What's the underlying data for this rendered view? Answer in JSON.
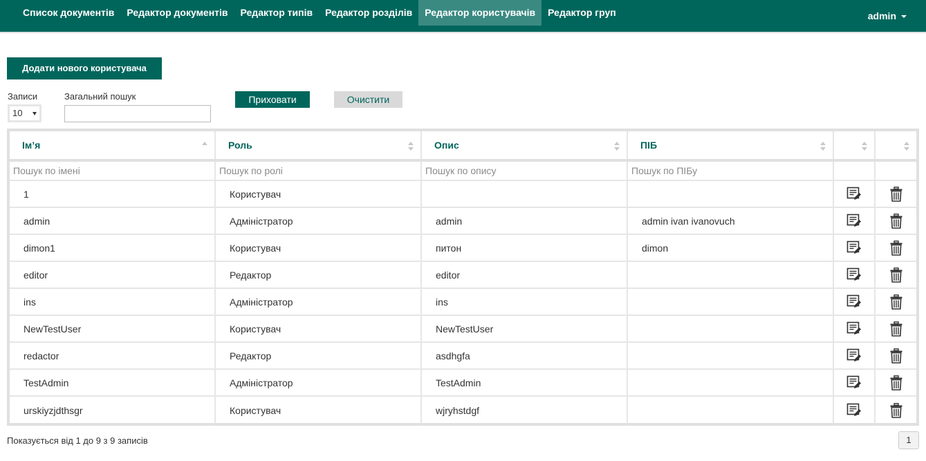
{
  "nav": {
    "items": [
      {
        "label": "Список документів",
        "active": false
      },
      {
        "label": "Редактор документів",
        "active": false
      },
      {
        "label": "Редактор типів",
        "active": false
      },
      {
        "label": "Редактор розділів",
        "active": false
      },
      {
        "label": "Редактор користувачів",
        "active": true
      },
      {
        "label": "Редактор груп",
        "active": false
      }
    ],
    "user": "admin"
  },
  "actions": {
    "add_user": "Додати нового користувача",
    "hide": "Приховати",
    "clear": "Очистити"
  },
  "controls": {
    "records_label": "Записи",
    "records_value": "10",
    "search_label": "Загальний пошук",
    "search_value": ""
  },
  "table": {
    "headers": [
      "Ім’я",
      "Роль",
      "Опис",
      "ПІБ"
    ],
    "filters": [
      "Пошук по імені",
      "Пошук по ролі",
      "Пошук по опису",
      "Пошук по ПІБу"
    ],
    "rows": [
      {
        "name": "1",
        "role": "Користувач",
        "desc": "",
        "pib": ""
      },
      {
        "name": "admin",
        "role": "Адміністратор",
        "desc": "admin",
        "pib": "admin ivan ivanovuch"
      },
      {
        "name": "dimon1",
        "role": "Користувач",
        "desc": "питон",
        "pib": "dimon"
      },
      {
        "name": "editor",
        "role": "Редактор",
        "desc": "editor",
        "pib": ""
      },
      {
        "name": "ins",
        "role": "Адміністратор",
        "desc": "ins",
        "pib": ""
      },
      {
        "name": "NewTestUser",
        "role": "Користувач",
        "desc": "NewTestUser",
        "pib": ""
      },
      {
        "name": "redactor",
        "role": "Редактор",
        "desc": "asdhgfa",
        "pib": ""
      },
      {
        "name": "TestAdmin",
        "role": "Адміністратор",
        "desc": "TestAdmin",
        "pib": ""
      },
      {
        "name": "urskiyzjdthsgr",
        "role": "Користувач",
        "desc": "wjryhstdgf",
        "pib": ""
      }
    ]
  },
  "footer": {
    "info": "Показується від 1 до 9 з 9 записів",
    "page": "1"
  },
  "colors": {
    "brand": "#00665c",
    "nav_active": "#3a8a82",
    "clear_button": "#d9d9d9"
  }
}
